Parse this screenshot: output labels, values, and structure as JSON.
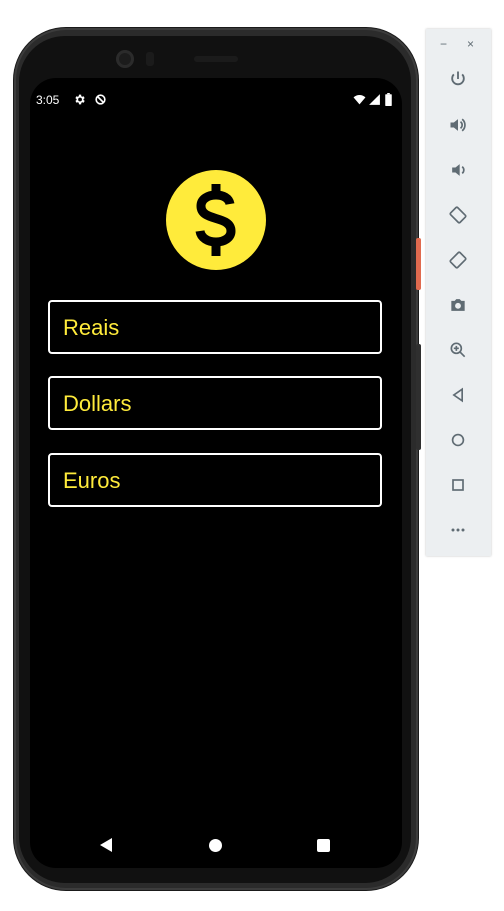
{
  "status_bar": {
    "time": "3:05"
  },
  "app": {
    "options": [
      {
        "label": "Reais"
      },
      {
        "label": "Dollars"
      },
      {
        "label": "Euros"
      }
    ]
  },
  "colors": {
    "accent": "#ffeb3b",
    "background": "#000000",
    "border": "#ffffff"
  },
  "toolbar": {
    "minimize": "−",
    "close": "×",
    "icons": [
      "power-icon",
      "volume-up-icon",
      "volume-down-icon",
      "rotate-left-icon",
      "rotate-right-icon",
      "camera-icon",
      "zoom-icon",
      "back-icon",
      "home-icon",
      "overview-icon",
      "more-icon"
    ]
  }
}
